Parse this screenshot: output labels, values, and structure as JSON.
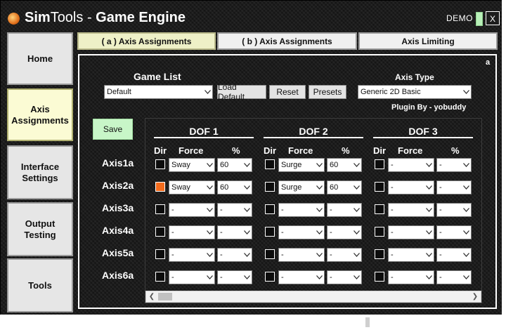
{
  "app": {
    "title_sim": "Sim",
    "title_tools": "Tools",
    "title_sep": " - ",
    "title_ge": "Game Engine",
    "demo_label": "DEMO",
    "close_label": "X"
  },
  "sidebar": {
    "items": [
      {
        "label": "Home",
        "active": false
      },
      {
        "label": "Axis Assignments",
        "active": true
      },
      {
        "label": "Interface Settings",
        "active": false
      },
      {
        "label": "Output Testing",
        "active": false
      },
      {
        "label": "Tools",
        "active": false
      }
    ]
  },
  "tabs": [
    {
      "label": "( a ) Axis Assignments",
      "active": true
    },
    {
      "label": "( b ) Axis Assignments",
      "active": false
    },
    {
      "label": "Axis Limiting",
      "active": false
    }
  ],
  "panel": {
    "corner_label": "a",
    "game_list_label": "Game List",
    "game_list_value": "Default",
    "load_default_label": "Load Default",
    "reset_label": "Reset",
    "presets_label": "Presets",
    "axis_type_label": "Axis Type",
    "axis_type_value": "Generic 2D Basic",
    "plugin_by": "Plugin By - yobuddy",
    "save_label": "Save"
  },
  "grid": {
    "dof_titles": [
      "DOF 1",
      "DOF 2",
      "DOF 3"
    ],
    "col_dir": "Dir",
    "col_force": "Force",
    "col_pct": "%",
    "axes": [
      {
        "label": "Axis1a",
        "dofs": [
          {
            "dir": false,
            "force": "Sway",
            "pct": "60"
          },
          {
            "dir": false,
            "force": "Surge",
            "pct": "60"
          },
          {
            "dir": false,
            "force": "-",
            "pct": "-"
          }
        ]
      },
      {
        "label": "Axis2a",
        "dofs": [
          {
            "dir": true,
            "force": "Sway",
            "pct": "60"
          },
          {
            "dir": false,
            "force": "Surge",
            "pct": "60"
          },
          {
            "dir": false,
            "force": "-",
            "pct": "-"
          }
        ]
      },
      {
        "label": "Axis3a",
        "dofs": [
          {
            "dir": false,
            "force": "-",
            "pct": "-"
          },
          {
            "dir": false,
            "force": "-",
            "pct": "-"
          },
          {
            "dir": false,
            "force": "-",
            "pct": "-"
          }
        ]
      },
      {
        "label": "Axis4a",
        "dofs": [
          {
            "dir": false,
            "force": "-",
            "pct": "-"
          },
          {
            "dir": false,
            "force": "-",
            "pct": "-"
          },
          {
            "dir": false,
            "force": "-",
            "pct": "-"
          }
        ]
      },
      {
        "label": "Axis5a",
        "dofs": [
          {
            "dir": false,
            "force": "-",
            "pct": "-"
          },
          {
            "dir": false,
            "force": "-",
            "pct": "-"
          },
          {
            "dir": false,
            "force": "-",
            "pct": "-"
          }
        ]
      },
      {
        "label": "Axis6a",
        "dofs": [
          {
            "dir": false,
            "force": "-",
            "pct": "-"
          },
          {
            "dir": false,
            "force": "-",
            "pct": "-"
          },
          {
            "dir": false,
            "force": "-",
            "pct": "-"
          }
        ]
      }
    ]
  },
  "colors": {
    "accent_active_dir": "#f36b1c",
    "save_green": "#c8f6c8",
    "active_sidebar": "#fbfbd4"
  }
}
